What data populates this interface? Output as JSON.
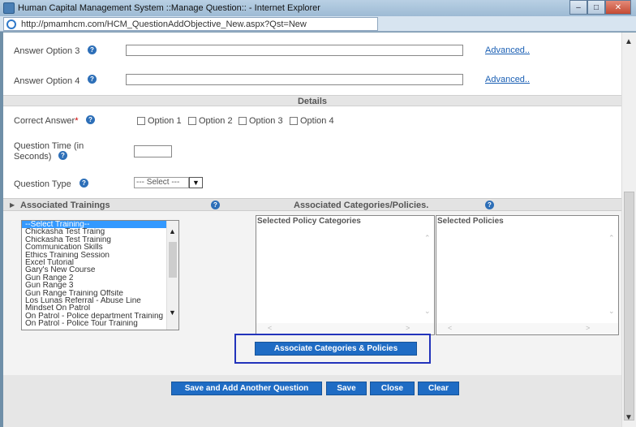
{
  "window": {
    "title": "Human Capital Management System ::Manage Question:: - Internet Explorer",
    "url": "http://pmamhcm.com/HCM_QuestionAddObjective_New.aspx?Qst=New"
  },
  "answer_options": [
    {
      "label": "Answer Option 3",
      "advanced": "Advanced.."
    },
    {
      "label": "Answer Option 4",
      "advanced": "Advanced.."
    }
  ],
  "details": {
    "title": "Details",
    "correct_answer_label": "Correct Answer",
    "required_mark": "*",
    "options": [
      "Option 1",
      "Option 2",
      "Option 3",
      "Option 4"
    ],
    "question_time_label_1": "Question Time (in",
    "question_time_label_2": "Seconds)",
    "question_type_label": "Question Type",
    "question_type_value": "--- Select ---"
  },
  "associations": {
    "trainings_title": "Associated Trainings",
    "categories_title": "Associated Categories/Policies.",
    "trainings": [
      "--Select Training--",
      "Chickasha Test Traing",
      "Chickasha Test Training",
      "Communication Skills",
      "Ethics Training Session",
      "Excel Tutorial",
      "Gary's New Course",
      "Gun Range 2",
      "Gun Range 3",
      "Gun Range Training Offsite",
      "Los Lunas Referral - Abuse Line",
      "Mindset On Patrol",
      "On Patrol - Police department Training",
      "On Patrol - Police Tour Training"
    ],
    "selected_policy_categories_title": "Selected Policy Categories",
    "selected_policies_title": "Selected Policies",
    "associate_button": "Associate Categories & Policies"
  },
  "footer": {
    "save_add_another": "Save and Add Another Question",
    "save": "Save",
    "close": "Close",
    "clear": "Clear"
  },
  "icons": {
    "help": "help-icon",
    "colors": {
      "accent": "#1f6cc4",
      "link": "#1a5fb4",
      "required": "#cc0000"
    }
  }
}
